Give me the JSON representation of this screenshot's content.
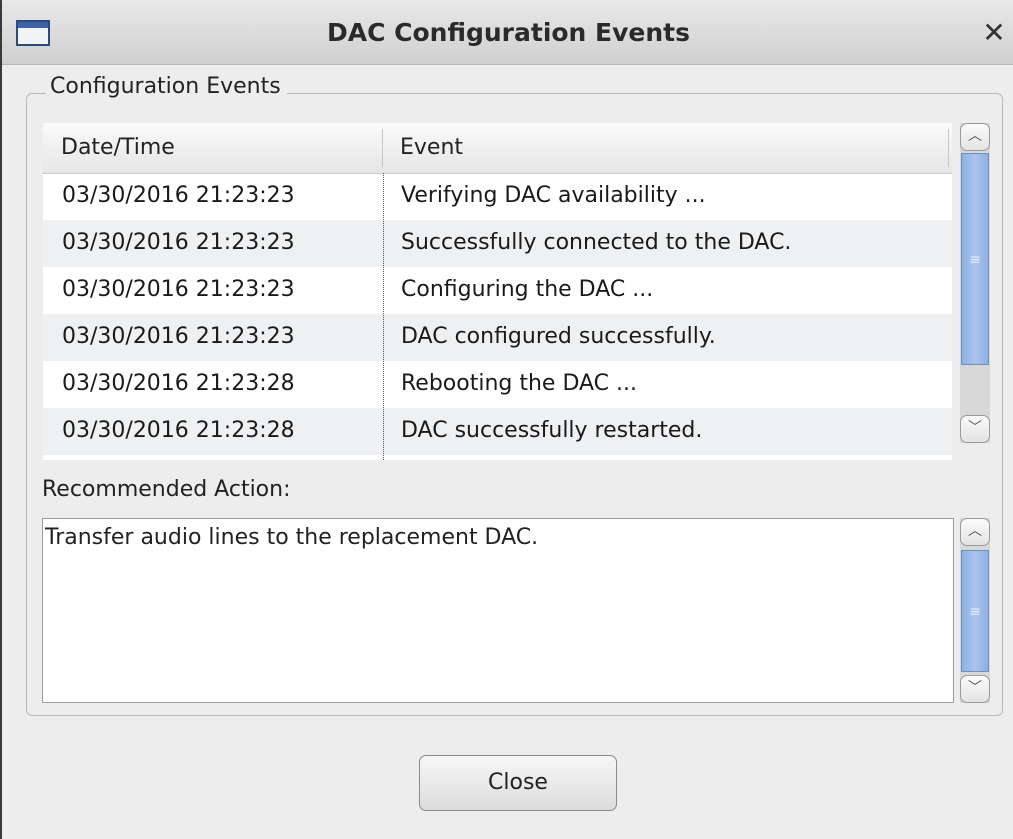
{
  "window": {
    "title": "DAC Configuration Events"
  },
  "group": {
    "legend": "Configuration Events"
  },
  "table": {
    "columns": [
      "Date/Time",
      "Event"
    ],
    "rows": [
      {
        "datetime": "03/30/2016 21:23:23",
        "event": "Verifying DAC availability ..."
      },
      {
        "datetime": "03/30/2016 21:23:23",
        "event": "Successfully connected to the DAC."
      },
      {
        "datetime": "03/30/2016 21:23:23",
        "event": "Configuring the DAC ..."
      },
      {
        "datetime": "03/30/2016 21:23:23",
        "event": "DAC configured successfully."
      },
      {
        "datetime": "03/30/2016 21:23:28",
        "event": "Rebooting the DAC ..."
      },
      {
        "datetime": "03/30/2016 21:23:28",
        "event": "DAC successfully restarted."
      }
    ]
  },
  "recommended": {
    "label": "Recommended Action:",
    "text": "Transfer audio lines to the replacement DAC."
  },
  "buttons": {
    "close": "Close"
  },
  "icons": {
    "window": "window-icon",
    "close": "close-icon",
    "scroll_up": "chevron-up-icon",
    "scroll_down": "chevron-down-icon",
    "grip": "grip-icon"
  },
  "colors": {
    "scroll_thumb": "#a9c4ec",
    "row_alt": "#eef0f2"
  }
}
